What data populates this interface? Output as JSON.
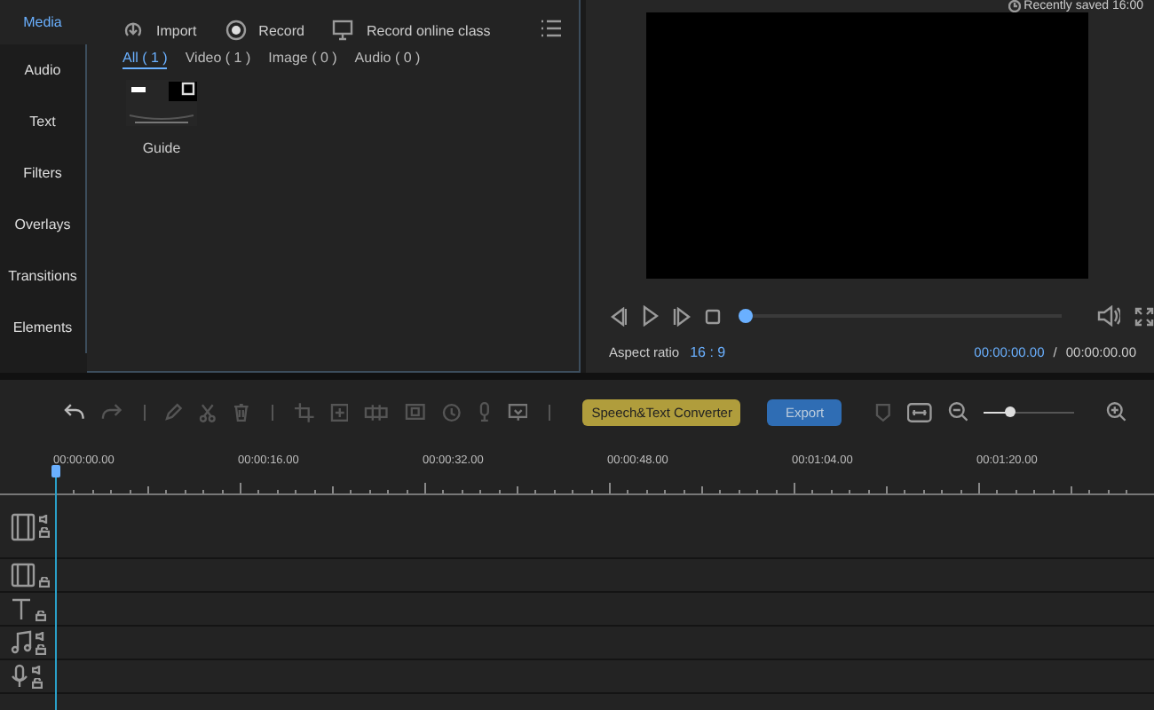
{
  "sidebar": {
    "items": [
      {
        "label": "Media",
        "selected": true
      },
      {
        "label": "Audio",
        "selected": false
      },
      {
        "label": "Text",
        "selected": false
      },
      {
        "label": "Filters",
        "selected": false
      },
      {
        "label": "Overlays",
        "selected": false
      },
      {
        "label": "Transitions",
        "selected": false
      },
      {
        "label": "Elements",
        "selected": false
      }
    ]
  },
  "media": {
    "actions": [
      {
        "kind": "import",
        "label": "Import"
      },
      {
        "kind": "record",
        "label": "Record"
      },
      {
        "kind": "screen",
        "label": "Record online class"
      }
    ],
    "filters": [
      {
        "label": "All ( 1 )",
        "selected": true
      },
      {
        "label": "Video ( 1 )",
        "selected": false
      },
      {
        "label": "Image ( 0 )",
        "selected": false
      },
      {
        "label": "Audio ( 0 )",
        "selected": false
      }
    ],
    "items": [
      {
        "label": "Guide"
      }
    ]
  },
  "preview": {
    "saved": "Recently saved 16:00",
    "progress": {
      "level": 0
    },
    "aspect_label": "Aspect ratio",
    "aspect_value": "16 : 9",
    "current_time": "00:00:00.00",
    "separator": "/",
    "total_time": "00:00:00.00"
  },
  "toolbar": {
    "speech_button": "Speech&Text Converter",
    "export_button": "Export",
    "zoom": {
      "level": 0.28
    }
  },
  "ruler": {
    "ticks": [
      "00:00:00.00",
      "00:00:16.00",
      "00:00:32.00",
      "00:00:48.00",
      "00:01:04.00",
      "00:01:20.00"
    ]
  },
  "tracks": [
    {
      "kind": "video",
      "audio": true
    },
    {
      "kind": "overlay",
      "audio": false
    },
    {
      "kind": "text",
      "audio": false
    },
    {
      "kind": "music",
      "audio": true
    },
    {
      "kind": "voice",
      "audio": true
    }
  ]
}
